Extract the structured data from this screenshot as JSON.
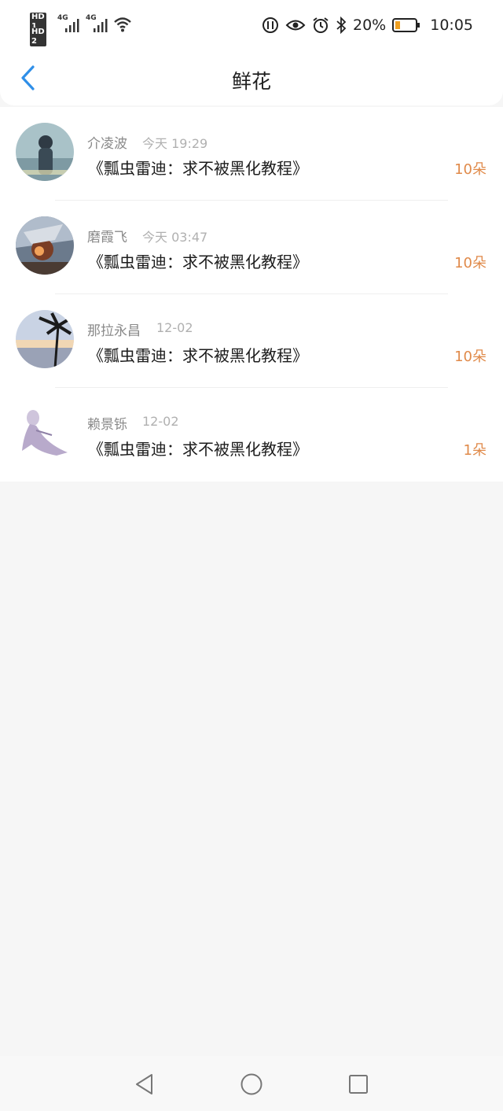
{
  "status_bar": {
    "sim1": "HD 1",
    "sim2": "HD 2",
    "net1": "4G",
    "net2": "4G",
    "battery": "20%",
    "time": "10:05",
    "icons": [
      "signal-icon",
      "wifi-icon",
      "data-saver-icon",
      "eye-icon",
      "alarm-icon",
      "bluetooth-icon",
      "battery-icon"
    ]
  },
  "header": {
    "title": "鲜花",
    "back_icon": "chevron-left-icon"
  },
  "items": [
    {
      "name": "介凌波",
      "time": "今天 19:29",
      "book": "《瓢虫雷迪：求不被黑化教程》",
      "count": "10朵"
    },
    {
      "name": "磨霞飞",
      "time": "今天 03:47",
      "book": "《瓢虫雷迪：求不被黑化教程》",
      "count": "10朵"
    },
    {
      "name": "那拉永昌",
      "time": "12-02",
      "book": "《瓢虫雷迪：求不被黑化教程》",
      "count": "10朵"
    },
    {
      "name": "赖景铄",
      "time": "12-02",
      "book": "《瓢虫雷迪：求不被黑化教程》",
      "count": "1朵"
    }
  ],
  "colors": {
    "accent": "#2f8fe8",
    "count": "#e08a4a"
  },
  "navbar": {
    "icons": [
      "back-triangle-icon",
      "home-circle-icon",
      "recents-square-icon"
    ]
  }
}
